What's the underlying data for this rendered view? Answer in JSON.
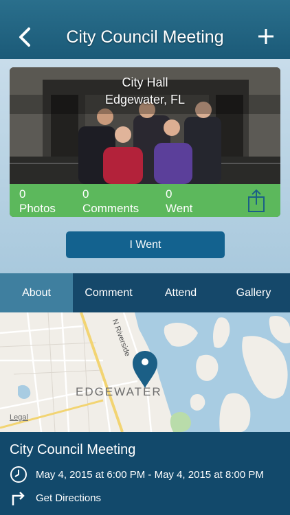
{
  "nav": {
    "title": "City Council Meeting",
    "back_icon": "chevron-left-icon",
    "add_icon": "plus-icon"
  },
  "card": {
    "place_name": "City Hall",
    "place_city": "Edgewater, FL",
    "stats": [
      {
        "count": "0",
        "label": "Photos"
      },
      {
        "count": "0",
        "label": "Comments"
      },
      {
        "count": "0",
        "label": "Went"
      }
    ],
    "share_icon": "share-icon",
    "stats_color": "#5cb85c"
  },
  "went_button": {
    "label": "I Went",
    "color": "#13628f"
  },
  "tabs": [
    {
      "label": "About",
      "active": true
    },
    {
      "label": "Comment",
      "active": false
    },
    {
      "label": "Attend",
      "active": false
    },
    {
      "label": "Gallery",
      "active": false
    }
  ],
  "map": {
    "city_label": "EDGEWATER",
    "street_label": "N Riverside",
    "legal": "Legal"
  },
  "event": {
    "title": "City Council Meeting",
    "time": "May 4, 2015 at 6:00 PM - May 4, 2015 at 8:00 PM",
    "directions": "Get Directions"
  },
  "colors": {
    "nav": "#1b5a78",
    "tab_bar": "#15486a",
    "tab_active": "#3f7f9f",
    "info_bg": "#12496b"
  }
}
